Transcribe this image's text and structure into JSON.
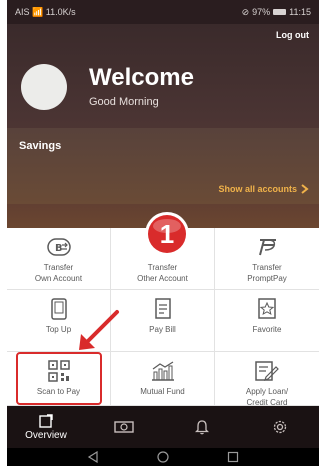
{
  "status_bar": {
    "carrier": "AIS",
    "speed": "11.0K/s",
    "battery": "97%",
    "time": "11:15"
  },
  "header": {
    "logout_label": "Log out",
    "welcome_title": "Welcome",
    "greeting": "Good Morning",
    "account_type": "Savings",
    "show_all_label": "Show all accounts"
  },
  "menu": {
    "items": [
      {
        "line1": "Transfer",
        "line2": "Own Account",
        "icon": "baht-transfer-icon"
      },
      {
        "line1": "Transfer",
        "line2": "Other Account",
        "icon": "transfer-icon"
      },
      {
        "line1": "Transfer",
        "line2": "PromptPay",
        "icon": "promptpay-icon"
      },
      {
        "line1": "Top Up",
        "line2": "",
        "icon": "phone-topup-icon"
      },
      {
        "line1": "Pay Bill",
        "line2": "",
        "icon": "bill-icon"
      },
      {
        "line1": "Favorite",
        "line2": "",
        "icon": "star-icon"
      },
      {
        "line1": "Scan to Pay",
        "line2": "",
        "icon": "qr-code-icon"
      },
      {
        "line1": "Mutual Fund",
        "line2": "",
        "icon": "chart-icon"
      },
      {
        "line1": "Apply Loan/",
        "line2": "Credit Card",
        "icon": "form-pen-icon"
      }
    ]
  },
  "annotation": {
    "step_number": "1",
    "highlight_color": "#d92b2b"
  },
  "tabs": {
    "overview_label": "Overview"
  },
  "colors": {
    "accent": "#f0b24a",
    "header_dark": "#3a2a2b",
    "tabbar": "#1a1213"
  }
}
